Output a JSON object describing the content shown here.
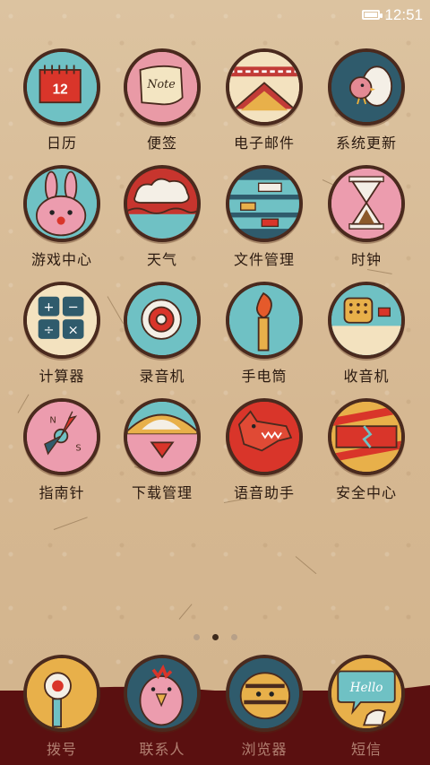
{
  "status": {
    "time": "12:51",
    "battery_level": 1.0
  },
  "apps": [
    {
      "label": "日历",
      "icon": "calendar-icon",
      "badge": "12"
    },
    {
      "label": "便签",
      "icon": "note-icon",
      "badge": "Note"
    },
    {
      "label": "电子邮件",
      "icon": "email-icon"
    },
    {
      "label": "系统更新",
      "icon": "bird-egg-icon"
    },
    {
      "label": "游戏中心",
      "icon": "rabbit-icon"
    },
    {
      "label": "天气",
      "icon": "cloud-icon"
    },
    {
      "label": "文件管理",
      "icon": "folder-icon"
    },
    {
      "label": "时钟",
      "icon": "hourglass-icon"
    },
    {
      "label": "计算器",
      "icon": "calculator-icon"
    },
    {
      "label": "录音机",
      "icon": "recorder-icon"
    },
    {
      "label": "手电筒",
      "icon": "torch-icon"
    },
    {
      "label": "收音机",
      "icon": "radio-icon"
    },
    {
      "label": "指南针",
      "icon": "compass-icon"
    },
    {
      "label": "下载管理",
      "icon": "download-icon"
    },
    {
      "label": "语音助手",
      "icon": "wolf-icon"
    },
    {
      "label": "安全中心",
      "icon": "shield-icon"
    }
  ],
  "dock": [
    {
      "label": "拨号",
      "icon": "phone-icon"
    },
    {
      "label": "联系人",
      "icon": "chicken-icon"
    },
    {
      "label": "浏览器",
      "icon": "bee-icon"
    },
    {
      "label": "短信",
      "icon": "hello-bubble-icon",
      "badge": "Hello"
    }
  ],
  "pager": {
    "pages": 3,
    "current": 2
  }
}
